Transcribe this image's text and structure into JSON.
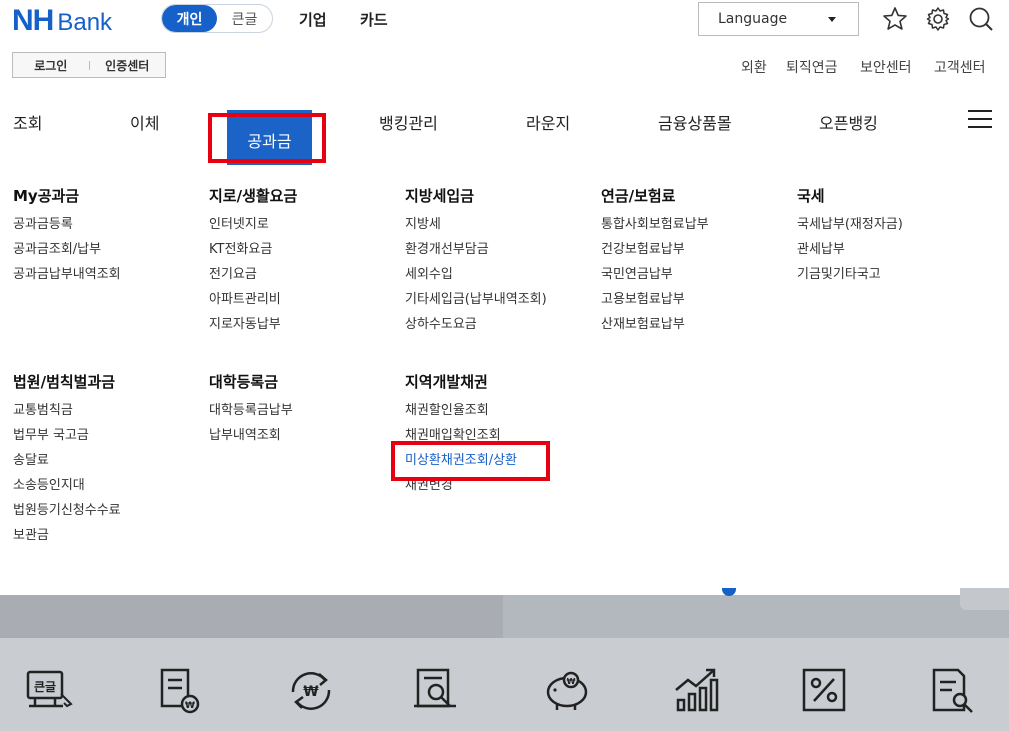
{
  "header": {
    "logo_nh": "NH",
    "logo_bank": "Bank",
    "segment": {
      "active": "개인",
      "inactive": "큰글"
    },
    "top_links": [
      "기업",
      "카드"
    ],
    "language": "Language",
    "icons": [
      "star-icon",
      "gear-icon",
      "search-icon"
    ]
  },
  "utility": {
    "login": "로그인",
    "cert": "인증센터",
    "links": [
      "외환",
      "퇴직연금",
      "보안센터",
      "고객센터"
    ]
  },
  "gnb": {
    "items": [
      "조회",
      "이체",
      "공과금",
      "뱅킹관리",
      "라운지",
      "금융상품몰",
      "오픈뱅킹"
    ],
    "active": "공과금"
  },
  "menu": {
    "columns_row1": [
      {
        "title": "My공과금",
        "items": [
          "공과금등록",
          "공과금조회/납부",
          "공과금납부내역조회"
        ]
      },
      {
        "title": "지로/생활요금",
        "items": [
          "인터넷지로",
          "KT전화요금",
          "전기요금",
          "아파트관리비",
          "지로자동납부"
        ]
      },
      {
        "title": "지방세입금",
        "items": [
          "지방세",
          "환경개선부담금",
          "세외수입",
          "기타세입금(납부내역조회)",
          "상하수도요금"
        ]
      },
      {
        "title": "연금/보험료",
        "items": [
          "통합사회보험료납부",
          "건강보험료납부",
          "국민연금납부",
          "고용보험료납부",
          "산재보험료납부"
        ]
      },
      {
        "title": "국세",
        "items": [
          "국세납부(재정자금)",
          "관세납부",
          "기금및기타국고"
        ]
      }
    ],
    "columns_row2": [
      {
        "title": "법원/범칙벌과금",
        "items": [
          "교통범칙금",
          "법무부 국고금",
          "송달료",
          "소송등인지대",
          "법원등기신청수수료",
          "보관금"
        ]
      },
      {
        "title": "대학등록금",
        "items": [
          "대학등록금납부",
          "납부내역조회"
        ]
      },
      {
        "title": "지역개발채권",
        "items": [
          "채권할인율조회",
          "채권매입확인조회",
          "미상환채권조회/상환",
          "채권변경"
        ]
      }
    ],
    "selected_item": "미상환채권조회/상환"
  },
  "quick_icons": [
    "large-text-icon",
    "bill-won-icon",
    "exchange-won-icon",
    "search-document-icon",
    "piggy-bank-icon",
    "growth-chart-icon",
    "percent-icon",
    "document-search-icon"
  ],
  "colors": {
    "brand": "#1560c9",
    "highlight": "#e60012"
  }
}
